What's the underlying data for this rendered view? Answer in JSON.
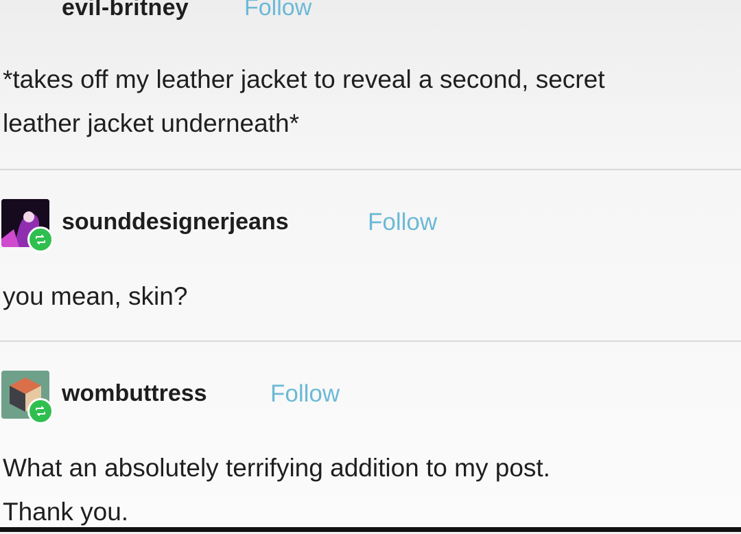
{
  "posts": [
    {
      "username": "evil-britney",
      "follow_label": "Follow",
      "text_lines": [
        "*takes off my leather jacket to reveal a second, secret",
        "leather jacket underneath*"
      ]
    },
    {
      "username": "sounddesignerjeans",
      "follow_label": "Follow",
      "avatar_icon": "purple-portrait-avatar",
      "badge_icon": "reblog-icon",
      "text_lines": [
        "you mean, skin?"
      ]
    },
    {
      "username": "wombuttress",
      "follow_label": "Follow",
      "avatar_icon": "cube-avatar",
      "badge_icon": "reblog-icon",
      "text_lines": [
        "What an absolutely terrifying addition to my post.",
        "Thank you."
      ]
    }
  ],
  "colors": {
    "follow": "#6bb9d6",
    "reblog_badge": "#2fbf4f",
    "divider": "#d8d8d8"
  }
}
